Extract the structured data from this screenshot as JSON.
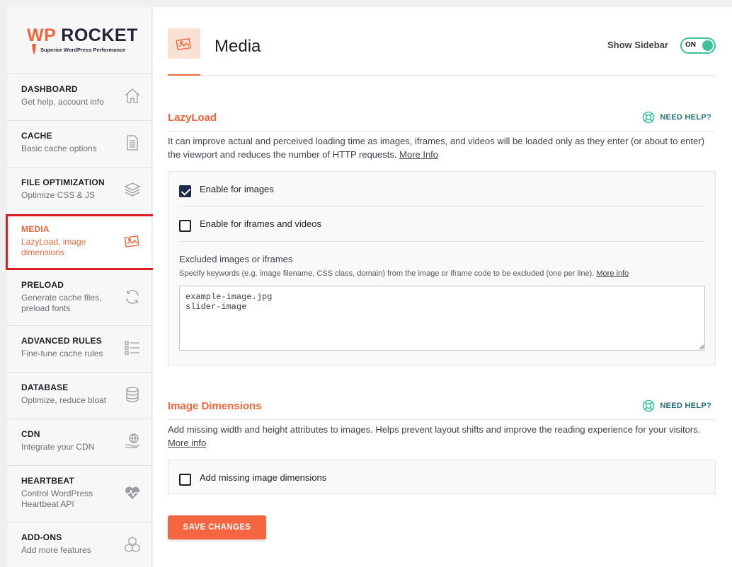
{
  "brand": {
    "wp": "WP",
    "rocket": "ROCKET",
    "tagline": "Superior WordPress Performance"
  },
  "sidebar": {
    "items": [
      {
        "title": "DASHBOARD",
        "desc": "Get help, account info",
        "icon": "home-icon"
      },
      {
        "title": "CACHE",
        "desc": "Basic cache options",
        "icon": "document-icon"
      },
      {
        "title": "FILE OPTIMIZATION",
        "desc": "Optimize CSS & JS",
        "icon": "layers-icon"
      },
      {
        "title": "MEDIA",
        "desc": "LazyLoad, image dimensions",
        "icon": "image-icon",
        "active": true
      },
      {
        "title": "PRELOAD",
        "desc": "Generate cache files, preload fonts",
        "icon": "refresh-icon"
      },
      {
        "title": "ADVANCED RULES",
        "desc": "Fine-tune cache rules",
        "icon": "checklist-icon"
      },
      {
        "title": "DATABASE",
        "desc": "Optimize, reduce bloat",
        "icon": "database-icon"
      },
      {
        "title": "CDN",
        "desc": "Integrate your CDN",
        "icon": "globe-hand-icon"
      },
      {
        "title": "HEARTBEAT",
        "desc": "Control WordPress Heartbeat API",
        "icon": "heartbeat-icon"
      },
      {
        "title": "ADD-ONS",
        "desc": "Add more features",
        "icon": "cubes-icon"
      }
    ]
  },
  "header": {
    "title": "Media",
    "show_sidebar_label": "Show Sidebar",
    "toggle_state": "ON"
  },
  "lazyload": {
    "title": "LazyLoad",
    "need_help": "NEED HELP?",
    "desc": "It can improve actual and perceived loading time as images, iframes, and videos will be loaded only as they enter (or about to enter) the viewport and reduces the number of HTTP requests.",
    "more_info": "More Info",
    "opt_images": {
      "label": "Enable for images",
      "checked": true
    },
    "opt_iframes": {
      "label": "Enable for iframes and videos",
      "checked": false
    },
    "excluded_title": "Excluded images or iframes",
    "excluded_desc": "Specify keywords (e.g. image filename, CSS class, domain) from the image or iframe code to be excluded (one per line).",
    "excluded_more": "More info",
    "excluded_value": "example-image.jpg\nslider-image"
  },
  "dimensions": {
    "title": "Image Dimensions",
    "need_help": "NEED HELP?",
    "desc": "Add missing width and height attributes to images. Helps prevent layout shifts and improve the reading experience for your visitors.",
    "more_info": "More info",
    "opt_add": {
      "label": "Add missing image dimensions",
      "checked": false
    }
  },
  "save_label": "SAVE CHANGES",
  "colors": {
    "accent": "#f0653a",
    "toggle": "#3bc49a",
    "help": "#1f6f7a",
    "highlight": "#d91f26"
  }
}
